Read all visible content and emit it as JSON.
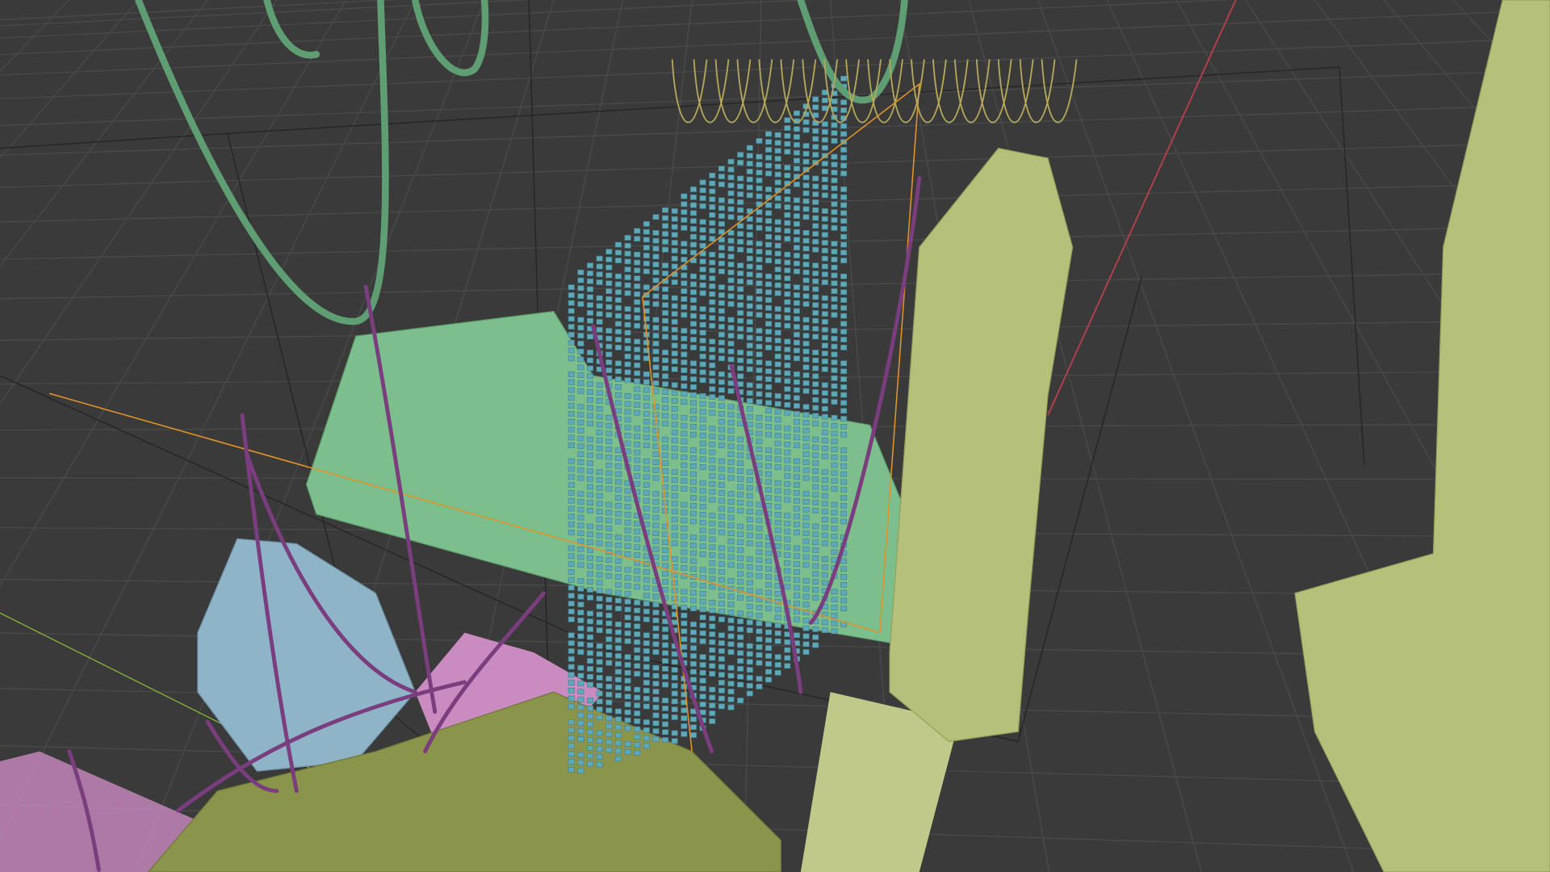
{
  "viewport": {
    "mode": "3D viewport",
    "colors": {
      "background": "#3b3b3b",
      "grid": "#4a4a4a",
      "sculpt_green": "#7dbf8c",
      "sculpt_olive": "#b5c07a",
      "sculpt_blue": "#8fb4c8",
      "sculpt_pink": "#c98bc0",
      "voxel_cyan": "#5fa8b8",
      "curve_purple": "#7a3d7d",
      "curve_green": "#5e9e72",
      "curve_yellow": "#b5a85a",
      "bbox_orange": "#e0922a",
      "axis_red": "#b8404a",
      "axis_green": "#7fa83a"
    },
    "objects": [
      "green-sculpt-mesh",
      "olive-statue",
      "olive-bust",
      "blue-sculpt",
      "pink-sculpt",
      "voxel-panel",
      "purple-curves",
      "green-tube-curves",
      "yellow-curves"
    ]
  }
}
